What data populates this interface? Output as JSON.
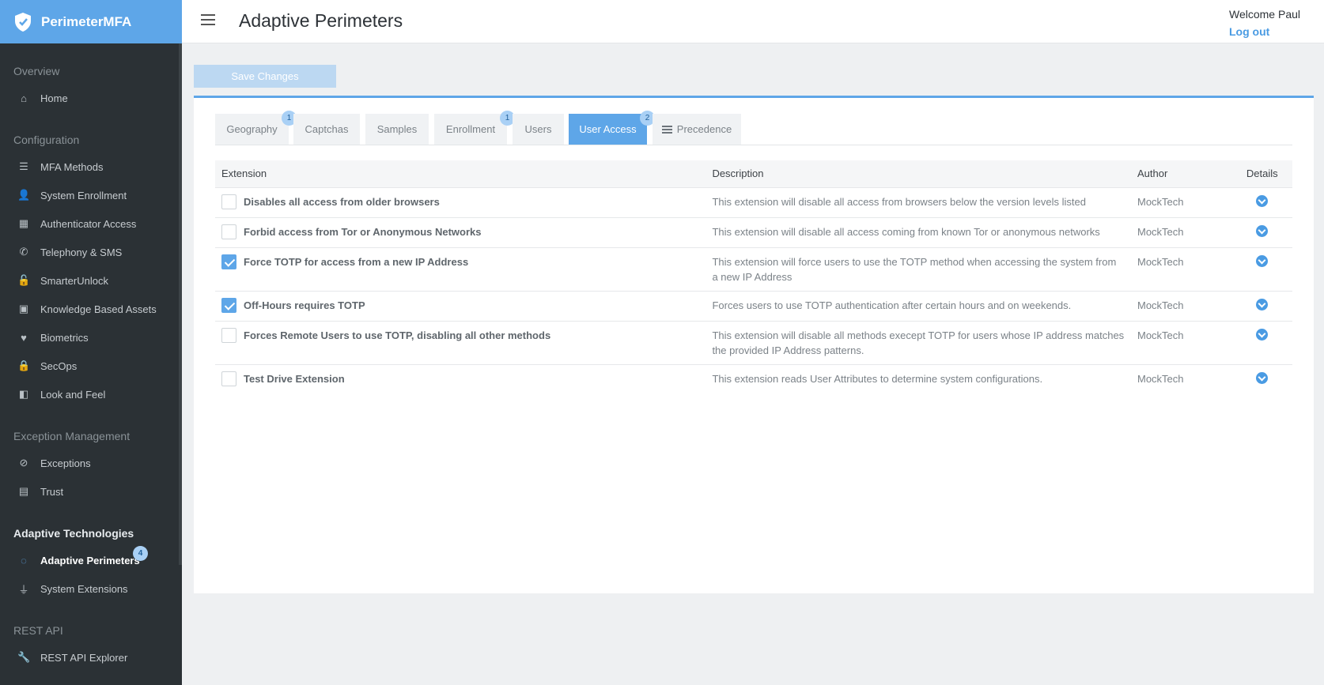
{
  "brand": {
    "name": "PerimeterMFA"
  },
  "header": {
    "title": "Adaptive Perimeters",
    "welcome": "Welcome Paul",
    "logout": "Log out"
  },
  "sidebar": {
    "sections": [
      {
        "title": "Overview",
        "items": [
          {
            "label": "Home",
            "icon": "home-icon"
          }
        ]
      },
      {
        "title": "Configuration",
        "items": [
          {
            "label": "MFA Methods",
            "icon": "list-icon"
          },
          {
            "label": "System Enrollment",
            "icon": "user-plus-icon"
          },
          {
            "label": "Authenticator Access",
            "icon": "qr-icon"
          },
          {
            "label": "Telephony & SMS",
            "icon": "phone-icon"
          },
          {
            "label": "SmarterUnlock",
            "icon": "unlock-icon"
          },
          {
            "label": "Knowledge Based Assets",
            "icon": "user-book-icon"
          },
          {
            "label": "Biometrics",
            "icon": "heartbeat-icon"
          },
          {
            "label": "SecOps",
            "icon": "lock-icon"
          },
          {
            "label": "Look and Feel",
            "icon": "palette-icon"
          }
        ]
      },
      {
        "title": "Exception Management",
        "items": [
          {
            "label": "Exceptions",
            "icon": "ban-icon"
          },
          {
            "label": "Trust",
            "icon": "id-card-icon"
          }
        ]
      },
      {
        "title": "Adaptive Technologies",
        "items": [
          {
            "label": "Adaptive Perimeters",
            "icon": "spinner-icon",
            "badge": "4"
          },
          {
            "label": "System Extensions",
            "icon": "plug-icon"
          }
        ]
      },
      {
        "title": "REST API",
        "items": [
          {
            "label": "REST API Explorer",
            "icon": "wrench-icon"
          }
        ]
      }
    ]
  },
  "toolbar": {
    "save_label": "Save Changes"
  },
  "tabs": [
    {
      "label": "Geography",
      "badge": "1"
    },
    {
      "label": "Captchas"
    },
    {
      "label": "Samples"
    },
    {
      "label": "Enrollment",
      "badge": "1"
    },
    {
      "label": "Users"
    },
    {
      "label": "User Access",
      "badge": "2",
      "active": true
    },
    {
      "label": "Precedence",
      "icon": "list-icon"
    }
  ],
  "table": {
    "columns": [
      "Extension",
      "Description",
      "Author",
      "Details"
    ],
    "rows": [
      {
        "name": "Disables all access from older browsers",
        "description": "This extension will disable all access from browsers below the version levels listed",
        "author": "MockTech",
        "checked": false
      },
      {
        "name": "Forbid access from Tor or Anonymous Networks",
        "description": "This extension will disable all access coming from known Tor or anonymous networks",
        "author": "MockTech",
        "checked": false
      },
      {
        "name": "Force TOTP for access from a new IP Address",
        "description": "This extension will force users to use the TOTP method when accessing the system from a new IP Address",
        "author": "MockTech",
        "checked": true
      },
      {
        "name": "Off-Hours requires TOTP",
        "description": "Forces users to use TOTP authentication after certain hours and on weekends.",
        "author": "MockTech",
        "checked": true
      },
      {
        "name": "Forces Remote Users to use TOTP, disabling all other methods",
        "description": "This extension will disable all methods execept TOTP for users whose IP address matches the provided IP Address patterns.",
        "author": "MockTech",
        "checked": false
      },
      {
        "name": "Test Drive Extension",
        "description": "This extension reads User Attributes to determine system configurations.",
        "author": "MockTech",
        "checked": false
      }
    ]
  },
  "colors": {
    "accent": "#5ea6e8",
    "sidebar": "#2b3135",
    "badge": "#a9d0f5"
  }
}
